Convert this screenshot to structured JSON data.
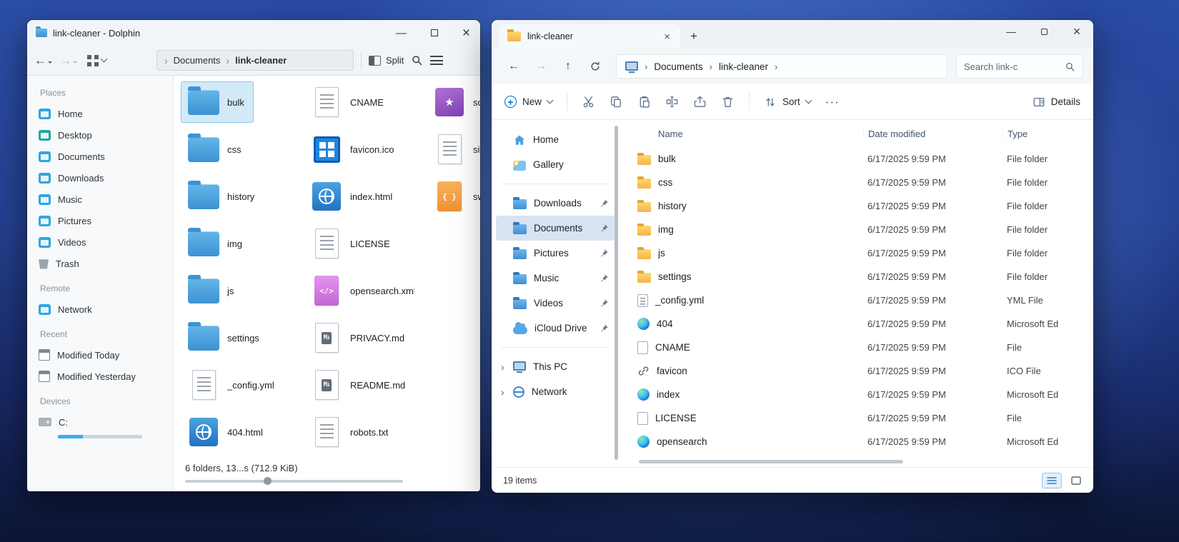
{
  "dolphin": {
    "title": "link-cleaner - Dolphin",
    "window_controls": {
      "minimize": "—",
      "close": "×"
    },
    "toolbar": {
      "split_label": "Split"
    },
    "breadcrumb": {
      "root": "Documents",
      "current": "link-cleaner"
    },
    "sidebar": {
      "sections": [
        {
          "label": "Places",
          "items": [
            {
              "label": "Home",
              "icon": "place",
              "color": "#2fa7dd"
            },
            {
              "label": "Desktop",
              "icon": "place",
              "color": "#1ba8a0"
            },
            {
              "label": "Documents",
              "icon": "place",
              "color": "#2fa7dd"
            },
            {
              "label": "Downloads",
              "icon": "place",
              "color": "#2fa7dd"
            },
            {
              "label": "Music",
              "icon": "place",
              "color": "#2fa7dd"
            },
            {
              "label": "Pictures",
              "icon": "place",
              "color": "#2fa7dd"
            },
            {
              "label": "Videos",
              "icon": "place",
              "color": "#2fa7dd"
            },
            {
              "label": "Trash",
              "icon": "trash",
              "color": "#9aa4ad"
            }
          ]
        },
        {
          "label": "Remote",
          "items": [
            {
              "label": "Network",
              "icon": "place",
              "color": "#2fa7dd"
            }
          ]
        },
        {
          "label": "Recent",
          "items": [
            {
              "label": "Modified Today",
              "icon": "calendar",
              "color": "#7b8794"
            },
            {
              "label": "Modified Yesterday",
              "icon": "calendar",
              "color": "#7b8794"
            }
          ]
        },
        {
          "label": "Devices",
          "items": [
            {
              "label": "C:",
              "icon": "drive",
              "color": "#aab3ba",
              "usage": 30
            }
          ]
        }
      ]
    },
    "files": {
      "columns": [
        [
          {
            "name": "bulk",
            "icon": "folder",
            "selected": true
          },
          {
            "name": "css",
            "icon": "folder"
          },
          {
            "name": "history",
            "icon": "folder"
          },
          {
            "name": "img",
            "icon": "folder"
          },
          {
            "name": "js",
            "icon": "folder"
          },
          {
            "name": "settings",
            "icon": "folder"
          },
          {
            "name": "_config.yml",
            "icon": "text"
          },
          {
            "name": "404.html",
            "icon": "html"
          }
        ],
        [
          {
            "name": "CNAME",
            "icon": "text"
          },
          {
            "name": "favicon.ico",
            "icon": "ico"
          },
          {
            "name": "index.html",
            "icon": "html"
          },
          {
            "name": "LICENSE",
            "icon": "text"
          },
          {
            "name": "opensearch.xml",
            "icon": "xml"
          },
          {
            "name": "PRIVACY.md",
            "icon": "md"
          },
          {
            "name": "README.md",
            "icon": "md"
          },
          {
            "name": "robots.txt",
            "icon": "text"
          }
        ],
        [
          {
            "name": "scr",
            "icon": "image"
          },
          {
            "name": "site",
            "icon": "text"
          },
          {
            "name": "sw.",
            "icon": "code"
          }
        ]
      ]
    },
    "status": "6 folders, 13...s (712.9 KiB)"
  },
  "explorer": {
    "tab_title": "link-cleaner",
    "breadcrumb": {
      "items": [
        "Documents",
        "link-cleaner"
      ]
    },
    "search_text": "Search link-c",
    "toolbar": {
      "new_label": "New",
      "sort_label": "Sort",
      "more_label": "···",
      "details_label": "Details"
    },
    "sidebar": {
      "items": [
        {
          "label": "Home",
          "icon": "home"
        },
        {
          "label": "Gallery",
          "icon": "gallery"
        },
        {
          "sep": true
        },
        {
          "label": "Downloads",
          "icon": "qafolder",
          "pinned": true
        },
        {
          "label": "Documents",
          "icon": "qafolder",
          "pinned": true,
          "selected": true
        },
        {
          "label": "Pictures",
          "icon": "qafolder",
          "pinned": true
        },
        {
          "label": "Music",
          "icon": "qafolder",
          "pinned": true
        },
        {
          "label": "Videos",
          "icon": "qafolder",
          "pinned": true
        },
        {
          "label": "iCloud Drive",
          "icon": "cloud",
          "pinned": true
        },
        {
          "sep": true
        },
        {
          "label": "This PC",
          "icon": "pc",
          "chevron": true
        },
        {
          "label": "Network",
          "icon": "net",
          "chevron": true
        }
      ]
    },
    "columns": [
      "Name",
      "Date modified",
      "Type"
    ],
    "rows": [
      {
        "name": "bulk",
        "icon": "folder",
        "date": "6/17/2025 9:59 PM",
        "type": "File folder"
      },
      {
        "name": "css",
        "icon": "folder",
        "date": "6/17/2025 9:59 PM",
        "type": "File folder"
      },
      {
        "name": "history",
        "icon": "folder",
        "date": "6/17/2025 9:59 PM",
        "type": "File folder"
      },
      {
        "name": "img",
        "icon": "folder",
        "date": "6/17/2025 9:59 PM",
        "type": "File folder"
      },
      {
        "name": "js",
        "icon": "folder",
        "date": "6/17/2025 9:59 PM",
        "type": "File folder"
      },
      {
        "name": "settings",
        "icon": "folder",
        "date": "6/17/2025 9:59 PM",
        "type": "File folder"
      },
      {
        "name": "_config.yml",
        "icon": "doc",
        "date": "6/17/2025 9:59 PM",
        "type": "YML File"
      },
      {
        "name": "404",
        "icon": "edge",
        "date": "6/17/2025 9:59 PM",
        "type": "Microsoft Ed"
      },
      {
        "name": "CNAME",
        "icon": "docblank",
        "date": "6/17/2025 9:59 PM",
        "type": "File"
      },
      {
        "name": "favicon",
        "icon": "link",
        "date": "6/17/2025 9:59 PM",
        "type": "ICO File"
      },
      {
        "name": "index",
        "icon": "edge",
        "date": "6/17/2025 9:59 PM",
        "type": "Microsoft Ed"
      },
      {
        "name": "LICENSE",
        "icon": "docblank",
        "date": "6/17/2025 9:59 PM",
        "type": "File"
      },
      {
        "name": "opensearch",
        "icon": "edge",
        "date": "6/17/2025 9:59 PM",
        "type": "Microsoft Ed"
      }
    ],
    "status": "19 items"
  }
}
